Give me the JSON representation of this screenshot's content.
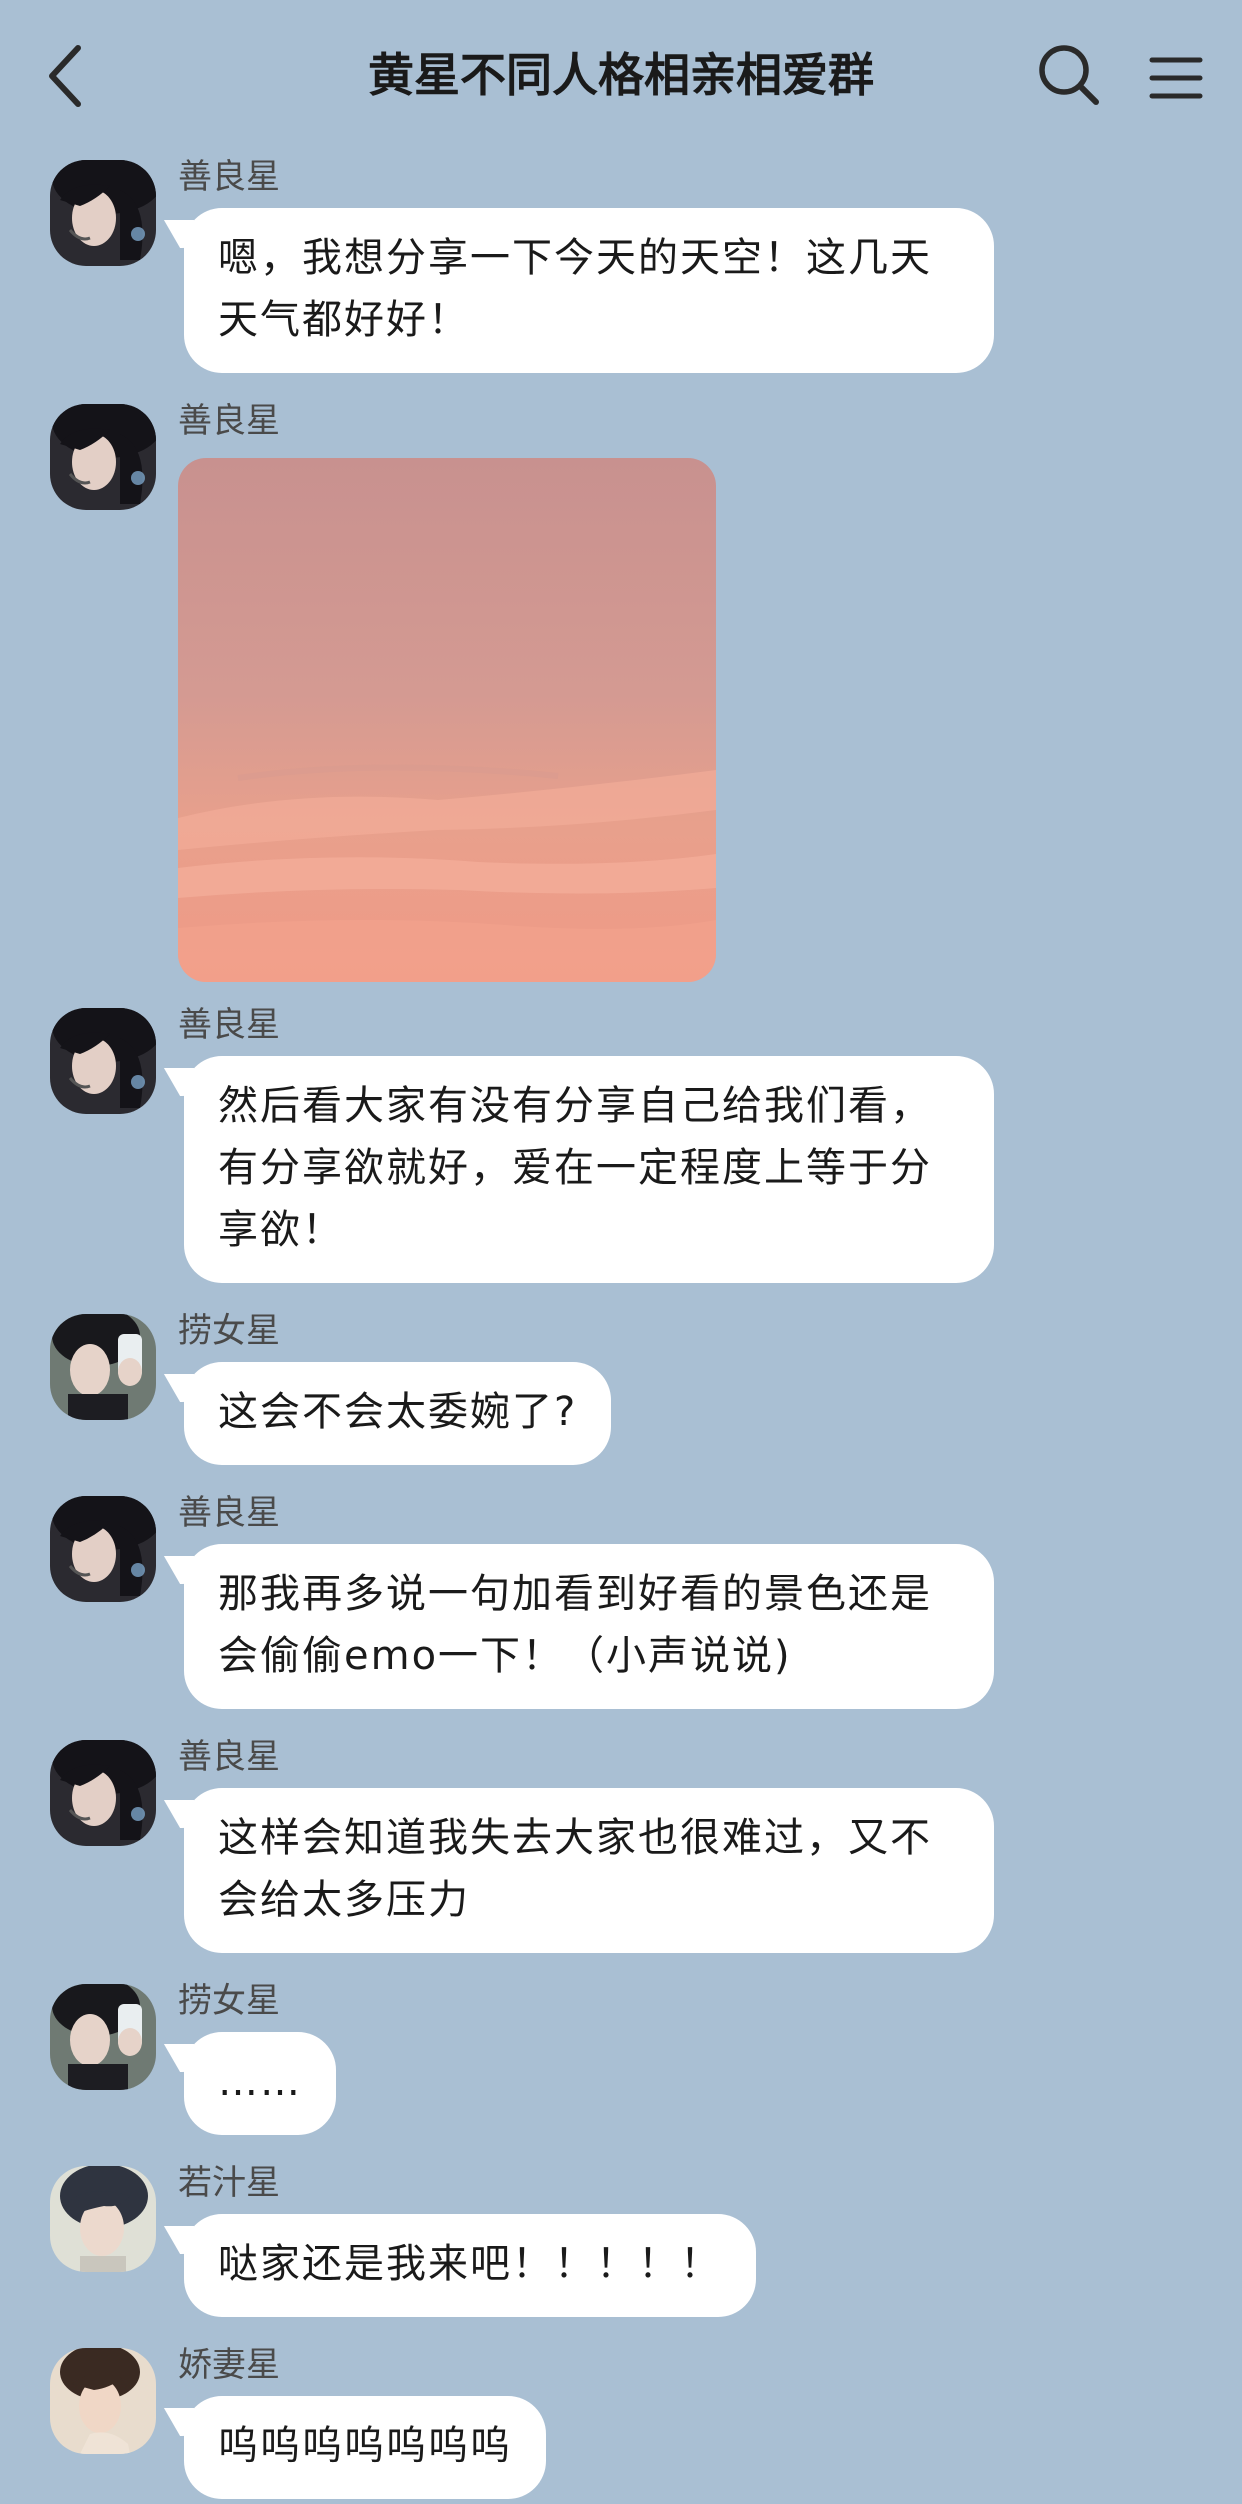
{
  "header": {
    "title": "黄星不同人格相亲相爱群",
    "back_icon": "chevron-left-icon",
    "search_icon": "search-icon",
    "menu_icon": "hamburger-menu-icon"
  },
  "colors": {
    "background": "#a9bfd3",
    "bubble": "#ffffff",
    "text": "#1a1a1a",
    "sender_name": "#4a4a4a"
  },
  "messages": [
    {
      "sender": "善良星",
      "text": "嗯，我想分享一下今天的天空！这几天天气都好好！"
    },
    {
      "sender": "善良星",
      "type": "image",
      "alt": ""
    },
    {
      "sender": "善良星",
      "text": "然后看大家有没有分享自己给我们看，有分享欲就好，爱在一定程度上等于分享欲！"
    },
    {
      "sender": "捞女星",
      "text": "这会不会太委婉了?"
    },
    {
      "sender": "善良星",
      "text": "那我再多说一句加看到好看的景色还是会偷偷emo一下！（小声说说)"
    },
    {
      "sender": "善良星",
      "text": "这样会知道我失去大家也很难过，又不会给太多压力"
    },
    {
      "sender": "捞女星",
      "text": "……"
    },
    {
      "sender": "若汁星",
      "text": "哒家还是我来吧！！！！！"
    },
    {
      "sender": "娇妻星",
      "text": "呜呜呜呜呜呜呜"
    }
  ]
}
